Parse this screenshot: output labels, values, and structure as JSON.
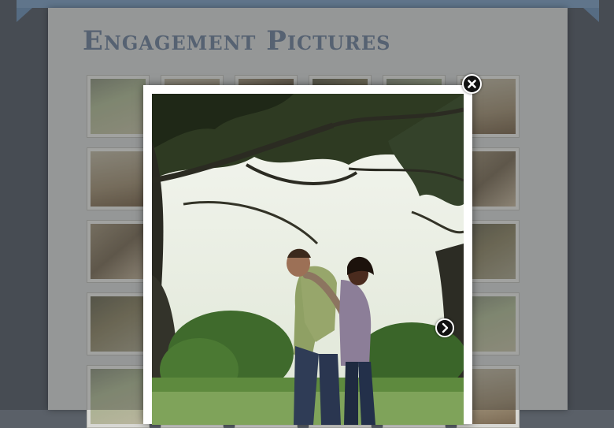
{
  "page": {
    "title": "Engagement Pictures"
  },
  "gallery": {
    "thumbnails": [
      "thumb",
      "thumb",
      "thumb",
      "thumb",
      "thumb",
      "thumb",
      "thumb",
      "thumb",
      "thumb",
      "thumb",
      "thumb",
      "thumb",
      "thumb",
      "thumb",
      "thumb",
      "thumb",
      "thumb",
      "thumb",
      "thumb",
      "thumb",
      "thumb",
      "thumb",
      "thumb",
      "thumb",
      "thumb",
      "thumb",
      "thumb",
      "thumb",
      "thumb",
      "thumb"
    ]
  },
  "lightbox": {
    "close_icon": "close-x-icon",
    "next_icon": "chevron-right-icon"
  },
  "colors": {
    "background": "#5a6068",
    "banner": "#7d99b6",
    "paper": "#c6c8c6",
    "title": "#6f7e93"
  }
}
